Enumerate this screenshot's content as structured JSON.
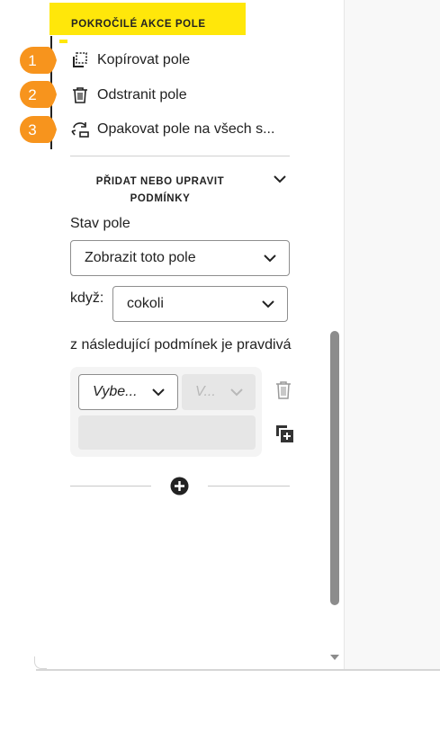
{
  "advanced": {
    "header": "POKROČILÉ AKCE POLE",
    "actions": [
      {
        "badge": "1",
        "label": "Kopírovat pole",
        "icon": "copy-field-icon"
      },
      {
        "badge": "2",
        "label": "Odstranit pole",
        "icon": "trash-icon"
      },
      {
        "badge": "3",
        "label": "Opakovat pole na všech s...",
        "icon": "repeat-icon"
      }
    ]
  },
  "conditions": {
    "header": "PŘIDAT NEBO UPRAVIT PODMÍNKY",
    "state_label": "Stav pole",
    "state_value": "Zobrazit toto pole",
    "when_label": "když:",
    "when_value": "cokoli",
    "condition_text": "z následující podmínek je pravdivá",
    "rule": {
      "field_placeholder": "Vybe...",
      "operator_placeholder": "V..."
    }
  },
  "colors": {
    "accent_yellow": "#ffe70a",
    "badge_orange": "#f7941d",
    "text": "#222222"
  }
}
